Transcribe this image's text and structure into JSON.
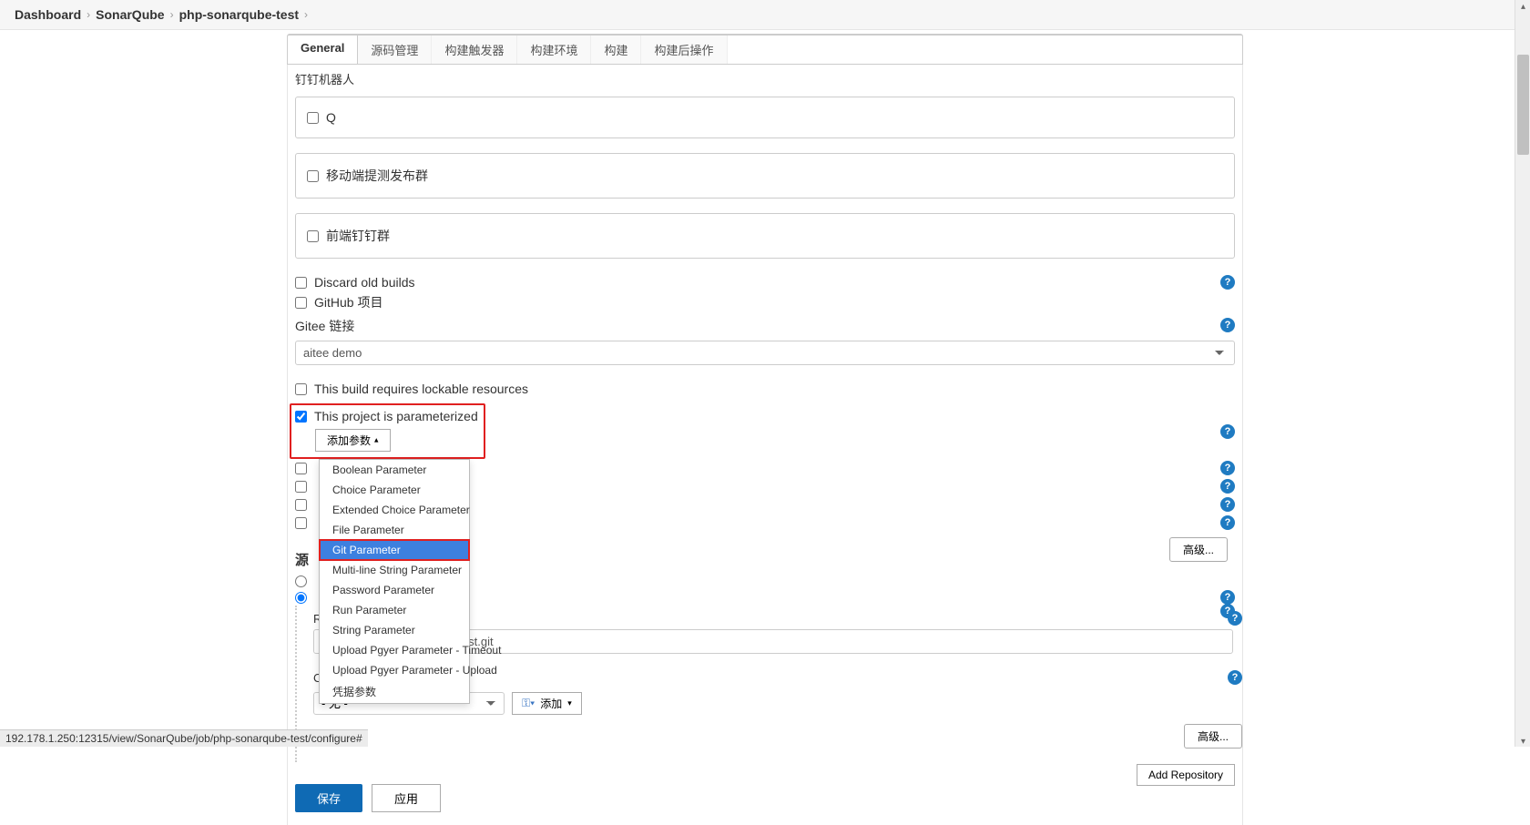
{
  "breadcrumb": {
    "items": [
      "Dashboard",
      "SonarQube",
      "php-sonarqube-test"
    ]
  },
  "tabs": {
    "items": [
      {
        "label": "General",
        "active": true
      },
      {
        "label": "源码管理",
        "active": false
      },
      {
        "label": "构建触发器",
        "active": false
      },
      {
        "label": "构建环境",
        "active": false
      },
      {
        "label": "构建",
        "active": false
      },
      {
        "label": "构建后操作",
        "active": false
      }
    ]
  },
  "general": {
    "dingtalk_heading": "钉钉机器人",
    "robots": [
      {
        "label": "Q"
      },
      {
        "label": "移动端提测发布群"
      },
      {
        "label": "前端钉钉群"
      }
    ],
    "discard_old_builds": "Discard old builds",
    "github_project": "GitHub 项目",
    "gitee_link_label": "Gitee 链接",
    "gitee_link_value": "aitee demo",
    "lockable": "This build requires lockable resources",
    "parameterized": "This project is parameterized",
    "add_param_label": "添加参数",
    "param_menu": [
      "Boolean Parameter",
      "Choice Parameter",
      "Extended Choice Parameter",
      "File Parameter",
      "Git Parameter",
      "Multi-line String Parameter",
      "Password Parameter",
      "Run Parameter",
      "String Parameter",
      "Upload Pgyer Parameter - Timeout",
      "Upload Pgyer Parameter - Upload",
      "凭据参数"
    ],
    "param_menu_hover_index": 4,
    "advanced_label": "高级...",
    "source_heading": "源",
    "repo_url_label": "Repository URL",
    "repo_url_value": "https://gitee.com/lijiafei/tp-test.git",
    "credentials_label": "Credentials",
    "credentials_value": "- 无 -",
    "add_cred_label": "添加",
    "add_repo_label": "Add Repository",
    "save_label": "保存",
    "apply_label": "应用"
  },
  "status_bar": "192.178.1.250:12315/view/SonarQube/job/php-sonarqube-test/configure#"
}
